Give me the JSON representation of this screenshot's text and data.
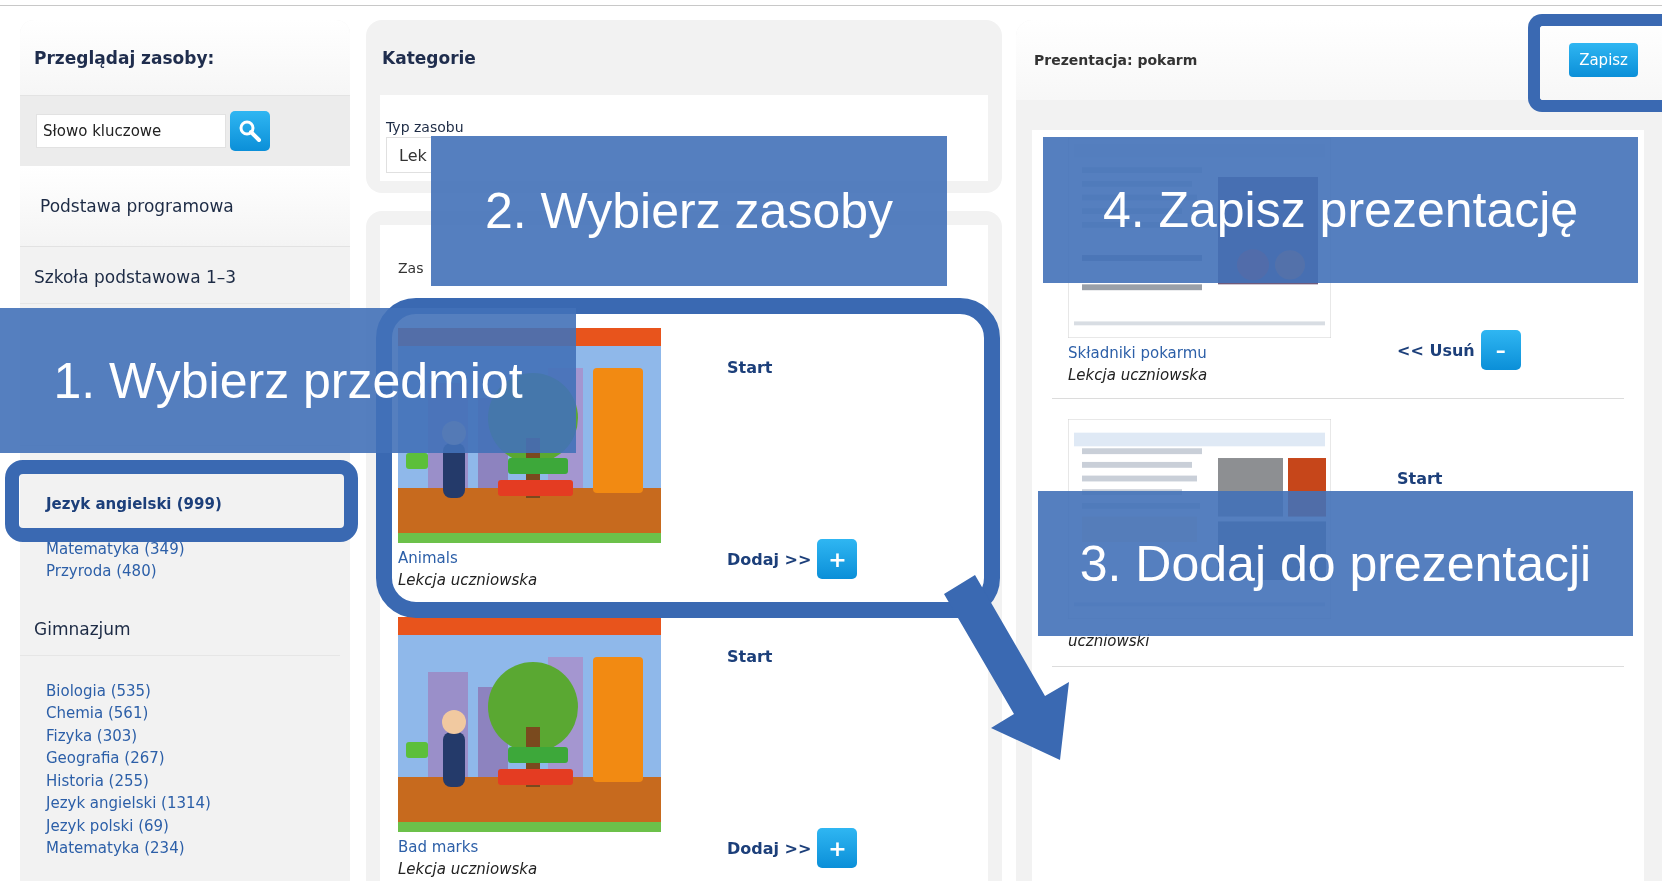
{
  "browse": {
    "title": "Przeglądaj zasoby:",
    "search": {
      "placeholder": "Słowo kluczowe"
    },
    "section_title": "Podstawa programowa",
    "groups": [
      {
        "title": "Szkoła podstawowa 1–3"
      },
      {
        "items": [
          {
            "label": "Jezyk angielski (999)",
            "selected": true
          },
          {
            "label": "Matematyka (349)",
            "selected": false
          },
          {
            "label": "Przyroda (480)",
            "selected": false
          }
        ]
      },
      {
        "title": "Gimnazjum",
        "items": [
          {
            "label": "Biologia (535)",
            "selected": false
          },
          {
            "label": "Chemia (561)",
            "selected": false
          },
          {
            "label": "Fizyka (303)",
            "selected": false
          },
          {
            "label": "Geografia (267)",
            "selected": false
          },
          {
            "label": "Historia (255)",
            "selected": false
          },
          {
            "label": "Jezyk angielski (1314)",
            "selected": false
          },
          {
            "label": "Jezyk polski (69)",
            "selected": false
          },
          {
            "label": "Matematyka (234)",
            "selected": false
          }
        ]
      }
    ]
  },
  "categories": {
    "title": "Kategorie",
    "filter": {
      "label": "Typ zasobu",
      "value": "Lek"
    }
  },
  "resources": {
    "summary": "Zas",
    "items": [
      {
        "title": "Animals",
        "type": "Lekcja uczniowska",
        "start": "Start",
        "add": "Dodaj >>",
        "add_icon": "+"
      },
      {
        "title": "Bad marks",
        "type": "Lekcja uczniowska",
        "start": "Start",
        "add": "Dodaj >>",
        "add_icon": "+"
      }
    ]
  },
  "presentation": {
    "title": "Prezentacja: pokarm",
    "save": "Zapisz",
    "items": [
      {
        "title": "Składniki pokarmu",
        "type": "Lekcja uczniowska",
        "remove": "<< Usuń",
        "remove_icon": "–"
      },
      {
        "type": "uczniowski",
        "start": "Start"
      }
    ]
  },
  "annotations": [
    "1. Wybierz przedmiot",
    "2. Wybierz zasoby",
    "4. Zapisz prezentację",
    "3. Dodaj do prezentacji"
  ]
}
